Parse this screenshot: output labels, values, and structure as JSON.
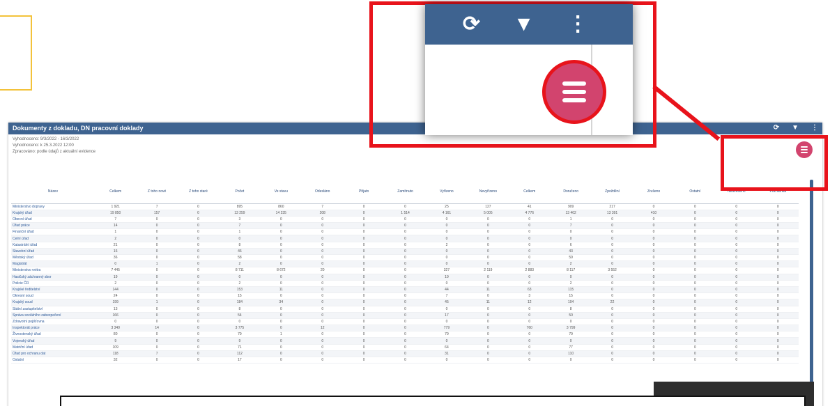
{
  "report": {
    "title": "Dokumenty z dokladu, DN pracovní doklady",
    "meta_lines": [
      "Vyhodnoceno: 9/3/2022 - 16/3/2022",
      "Vyhodnoceno: k 25.3.2022 12:00",
      "Zpracováno: podle údajů z aktuální evidence"
    ],
    "header_icons": [
      "refresh-icon",
      "filter-icon",
      "more-vertical-icon"
    ]
  },
  "zoom": {
    "icons": [
      "refresh-icon",
      "filter-icon",
      "more-vertical-icon"
    ],
    "fab_icon": "hamburger-menu-icon"
  },
  "table": {
    "columns": [
      "Název",
      "Celkem",
      "Z toho nové",
      "Z toho staré",
      "Počet",
      "Ve stavu",
      "Odesláno",
      "Přijato",
      "Zamítnuto",
      "Vyřízeno",
      "Nevyřízeno",
      "Celkem",
      "Doručeno",
      "Zpoždění",
      "Zrušeno",
      "Ostatní",
      "Neuvedeno",
      "Poznámka"
    ],
    "rows": [
      [
        "Ministerstvo dopravy",
        "1 921",
        "7",
        "0",
        "895",
        "860",
        "7",
        "0",
        "0",
        "25",
        "127",
        "41",
        "909",
        "217",
        "0",
        "0",
        "0",
        "0"
      ],
      [
        "Krajský úřad",
        "19 850",
        "157",
        "0",
        "13 259",
        "14 235",
        "208",
        "0",
        "1 514",
        "4 161",
        "5 005",
        "4 776",
        "13 402",
        "13 391",
        "410",
        "0",
        "0",
        "0"
      ],
      [
        "Obecní úřad",
        "7",
        "0",
        "0",
        "3",
        "0",
        "0",
        "0",
        "0",
        "0",
        "0",
        "0",
        "1",
        "0",
        "0",
        "0",
        "0",
        "0"
      ],
      [
        "Úřad práce",
        "14",
        "0",
        "0",
        "7",
        "0",
        "0",
        "0",
        "0",
        "0",
        "0",
        "0",
        "7",
        "0",
        "0",
        "0",
        "0",
        "0"
      ],
      [
        "Finanční úřad",
        "1",
        "0",
        "0",
        "1",
        "0",
        "0",
        "0",
        "0",
        "0",
        "0",
        "0",
        "0",
        "0",
        "0",
        "0",
        "0",
        "0"
      ],
      [
        "Celní úřad",
        "2",
        "0",
        "0",
        "0",
        "0",
        "0",
        "0",
        "0",
        "0",
        "0",
        "0",
        "0",
        "0",
        "0",
        "0",
        "0",
        "0"
      ],
      [
        "Katastrální úřad",
        "21",
        "0",
        "0",
        "8",
        "0",
        "0",
        "0",
        "0",
        "2",
        "0",
        "0",
        "6",
        "0",
        "0",
        "0",
        "0",
        "0"
      ],
      [
        "Stavební úřad",
        "16",
        "0",
        "0",
        "46",
        "0",
        "0",
        "0",
        "0",
        "0",
        "0",
        "0",
        "43",
        "0",
        "0",
        "0",
        "0",
        "0"
      ],
      [
        "Městský úřad",
        "36",
        "0",
        "0",
        "58",
        "0",
        "0",
        "0",
        "0",
        "0",
        "0",
        "0",
        "59",
        "0",
        "0",
        "0",
        "0",
        "0"
      ],
      [
        "Magistrát",
        "0",
        "1",
        "0",
        "2",
        "0",
        "0",
        "0",
        "0",
        "0",
        "0",
        "0",
        "2",
        "0",
        "0",
        "0",
        "0",
        "0"
      ],
      [
        "Ministerstvo vnitra",
        "7 445",
        "0",
        "0",
        "8 711",
        "8 672",
        "20",
        "0",
        "0",
        "327",
        "2 119",
        "2 883",
        "8 117",
        "3 552",
        "0",
        "0",
        "0",
        "0"
      ],
      [
        "Hasičský záchranný sbor",
        "19",
        "0",
        "0",
        "0",
        "0",
        "0",
        "0",
        "0",
        "19",
        "0",
        "0",
        "0",
        "0",
        "0",
        "0",
        "0",
        "0"
      ],
      [
        "Policie ČR",
        "2",
        "0",
        "0",
        "2",
        "0",
        "0",
        "0",
        "0",
        "0",
        "0",
        "0",
        "2",
        "0",
        "0",
        "0",
        "0",
        "0"
      ],
      [
        "Krajské ředitelství",
        "144",
        "0",
        "0",
        "153",
        "11",
        "0",
        "0",
        "0",
        "44",
        "11",
        "63",
        "115",
        "0",
        "0",
        "0",
        "0",
        "0"
      ],
      [
        "Okresní soud",
        "24",
        "0",
        "0",
        "15",
        "0",
        "0",
        "0",
        "0",
        "7",
        "0",
        "3",
        "15",
        "0",
        "0",
        "0",
        "0",
        "0"
      ],
      [
        "Krajský soud",
        "199",
        "1",
        "0",
        "184",
        "34",
        "0",
        "0",
        "0",
        "45",
        "11",
        "12",
        "104",
        "22",
        "0",
        "0",
        "0",
        "0"
      ],
      [
        "Státní zastupitelství",
        "13",
        "0",
        "0",
        "8",
        "0",
        "0",
        "0",
        "0",
        "0",
        "0",
        "0",
        "8",
        "0",
        "0",
        "0",
        "0",
        "0"
      ],
      [
        "Správa sociálního zabezpečení",
        "166",
        "0",
        "0",
        "54",
        "0",
        "0",
        "0",
        "0",
        "17",
        "0",
        "0",
        "50",
        "0",
        "0",
        "0",
        "0",
        "0"
      ],
      [
        "Zdravotní pojišťovna",
        "0",
        "0",
        "0",
        "0",
        "0",
        "0",
        "0",
        "0",
        "0",
        "0",
        "0",
        "0",
        "0",
        "0",
        "0",
        "0",
        "0"
      ],
      [
        "Inspektorát práce",
        "3 340",
        "14",
        "0",
        "3 775",
        "0",
        "12",
        "0",
        "0",
        "779",
        "0",
        "760",
        "3 799",
        "0",
        "0",
        "0",
        "0",
        "0"
      ],
      [
        "Živnostenský úřad",
        "80",
        "0",
        "0",
        "79",
        "1",
        "0",
        "0",
        "0",
        "79",
        "0",
        "0",
        "79",
        "0",
        "0",
        "0",
        "0",
        "0"
      ],
      [
        "Vojenský úřad",
        "9",
        "0",
        "0",
        "9",
        "0",
        "0",
        "0",
        "0",
        "0",
        "0",
        "0",
        "0",
        "0",
        "0",
        "0",
        "0",
        "0"
      ],
      [
        "Matriční úřad",
        "109",
        "0",
        "0",
        "71",
        "0",
        "0",
        "0",
        "0",
        "64",
        "0",
        "0",
        "77",
        "0",
        "0",
        "0",
        "0",
        "0"
      ],
      [
        "Úřad pro ochranu dat",
        "118",
        "7",
        "0",
        "112",
        "0",
        "0",
        "0",
        "0",
        "31",
        "0",
        "0",
        "110",
        "0",
        "0",
        "0",
        "0",
        "0"
      ],
      [
        "Ostatní",
        "32",
        "0",
        "0",
        "17",
        "0",
        "0",
        "0",
        "0",
        "0",
        "0",
        "0",
        "0",
        "0",
        "0",
        "0",
        "0",
        "0"
      ]
    ]
  },
  "colors": {
    "header_blue": "#3e6390",
    "fab_pink": "#d2446e",
    "highlight_red": "#e8131b",
    "orange_box": "#f3c23a"
  }
}
